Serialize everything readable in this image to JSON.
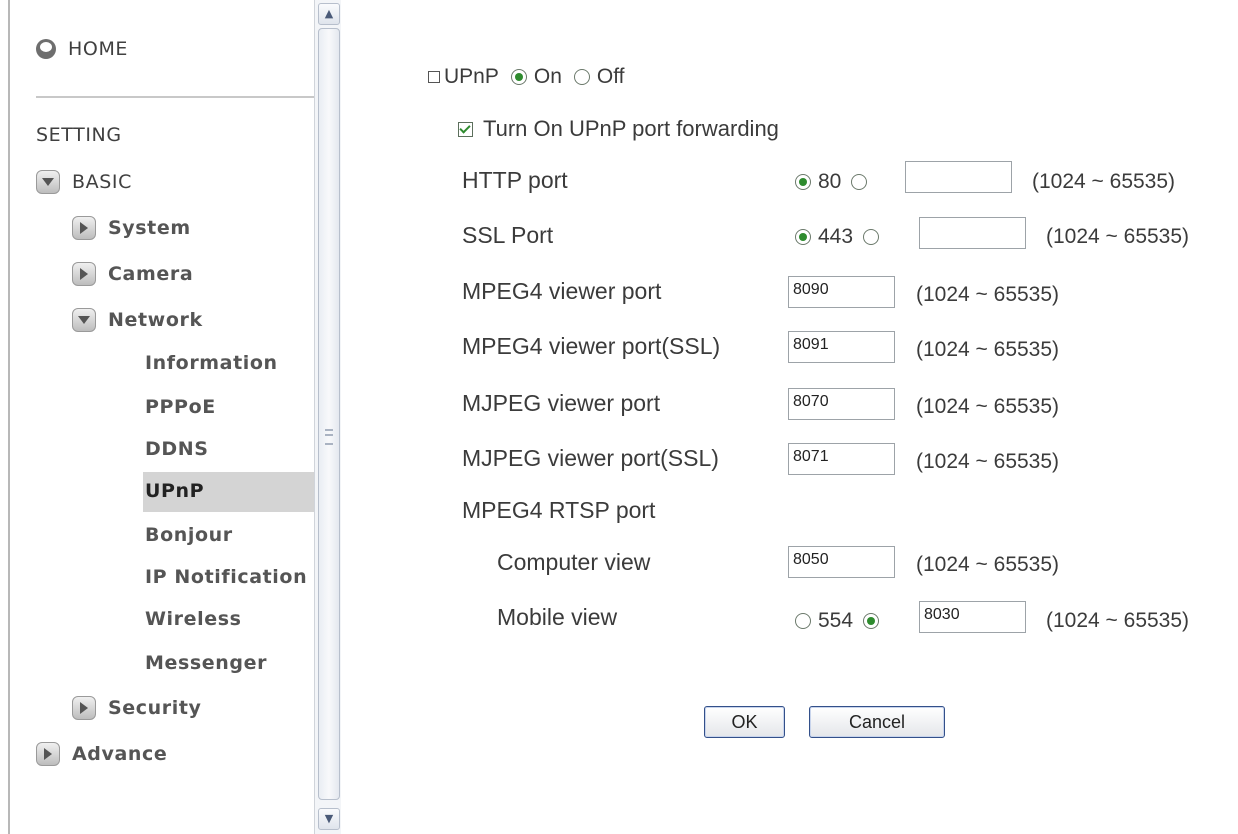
{
  "sidebar": {
    "home": "HOME",
    "setting": "SETTING",
    "basic": "BASIC",
    "basic_items": [
      "System",
      "Camera",
      "Network"
    ],
    "network_items": [
      "Information",
      "PPPoE",
      "DDNS",
      "UPnP",
      "Bonjour",
      "IP Notification",
      "Wireless",
      "Messenger"
    ],
    "security": "Security",
    "advance": "Advance",
    "selected": "UPnP"
  },
  "upnp": {
    "label": "UPnP",
    "on": "On",
    "off": "Off",
    "selected": "On",
    "forwarding_label": "Turn On UPnP port forwarding",
    "forwarding_checked": true
  },
  "ports": {
    "http": {
      "label": "HTTP port",
      "default": "80",
      "value": "",
      "range": "(1024 ~ 65535)"
    },
    "ssl": {
      "label": "SSL Port",
      "default": "443",
      "value": "",
      "range": "(1024 ~ 65535)"
    },
    "mpeg4": {
      "label": "MPEG4 viewer port",
      "value": "8090",
      "range": "(1024 ~ 65535)"
    },
    "mpeg4_ssl": {
      "label": "MPEG4 viewer port(SSL)",
      "value": "8091",
      "range": "(1024 ~ 65535)"
    },
    "mjpeg": {
      "label": "MJPEG viewer port",
      "value": "8070",
      "range": "(1024 ~ 65535)"
    },
    "mjpeg_ssl": {
      "label": "MJPEG viewer port(SSL)",
      "value": "8071",
      "range": "(1024 ~ 65535)"
    },
    "rtsp_label": "MPEG4 RTSP port",
    "computer": {
      "label": "Computer view",
      "value": "8050",
      "range": "(1024 ~ 65535)"
    },
    "mobile": {
      "label": "Mobile view",
      "default": "554",
      "value": "8030",
      "range": "(1024 ~ 65535)"
    }
  },
  "buttons": {
    "ok": "OK",
    "cancel": "Cancel"
  },
  "colors": {
    "radio_dot": "#2e8b2e",
    "selected_bg": "#d4d4d4",
    "button_border": "#33508a"
  },
  "icons": {
    "home": "home-icon",
    "expanded": "arrow-down-icon",
    "collapsed": "arrow-right-icon"
  }
}
